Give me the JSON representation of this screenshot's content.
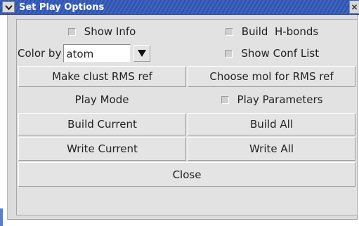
{
  "window": {
    "title": "Set Play Options",
    "menu_icon": "chevron-down-icon",
    "close_icon": "close-icon",
    "close_glyph": "×"
  },
  "options": {
    "show_info_label": "Show Info",
    "build_hbonds_label": "Build  H-bonds",
    "color_by_label": "Color by",
    "color_by_value": "atom",
    "show_conf_list_label": "Show Conf List",
    "make_clust_rms_ref_label": "Make clust RMS ref",
    "choose_mol_rms_ref_label": "Choose mol for RMS ref",
    "play_mode_label": "Play Mode",
    "play_parameters_label": "Play Parameters",
    "build_current_label": "Build Current",
    "build_all_label": "Build All",
    "write_current_label": "Write Current",
    "write_all_label": "Write All",
    "close_label": "Close"
  },
  "checkboxes": {
    "show_info": false,
    "build_hbonds": false,
    "show_conf_list": false,
    "play_parameters": false
  },
  "colors": {
    "titlebar": "#2f55b4",
    "panel": "#e2e2e2",
    "button": "#e4e4e4"
  }
}
